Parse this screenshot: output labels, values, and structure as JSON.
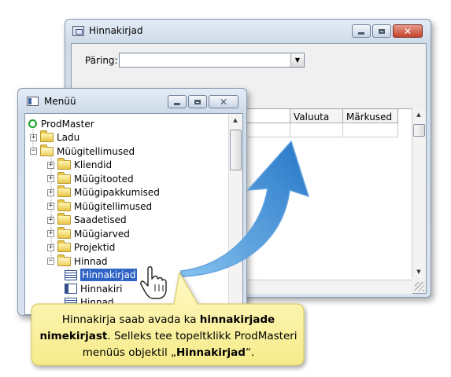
{
  "back_window": {
    "title": "Hinnakirjad",
    "query_label": "Päring:",
    "query_value": "",
    "columns": [
      "Valuuta",
      "Märkused"
    ]
  },
  "menu_window": {
    "title": "Menüü",
    "tree": [
      {
        "label": "ProdMaster",
        "level": 0,
        "type": "root"
      },
      {
        "label": "Ladu",
        "level": 1,
        "type": "folder",
        "expander": "+"
      },
      {
        "label": "Müügitellimused",
        "level": 1,
        "type": "folder-open",
        "expander": "-"
      },
      {
        "label": "Kliendid",
        "level": 2,
        "type": "folder",
        "expander": "+"
      },
      {
        "label": "Müügitooted",
        "level": 2,
        "type": "folder",
        "expander": "+"
      },
      {
        "label": "Müügipakkumised",
        "level": 2,
        "type": "folder",
        "expander": "+"
      },
      {
        "label": "Müügitellimused",
        "level": 2,
        "type": "folder",
        "expander": "+"
      },
      {
        "label": "Saadetised",
        "level": 2,
        "type": "folder",
        "expander": "+"
      },
      {
        "label": "Müügiarved",
        "level": 2,
        "type": "folder",
        "expander": "+"
      },
      {
        "label": "Projektid",
        "level": 2,
        "type": "folder",
        "expander": "+"
      },
      {
        "label": "Hinnad",
        "level": 2,
        "type": "folder-open",
        "expander": "-"
      },
      {
        "label": "Hinnakirjad",
        "level": 3,
        "type": "doc",
        "selected": true
      },
      {
        "label": "Hinnakiri",
        "level": 3,
        "type": "doc-alt"
      },
      {
        "label": "Hinnad",
        "level": 3,
        "type": "doc"
      }
    ]
  },
  "callout": {
    "part1": "Hinnakirja saab avada ka ",
    "bold1": "hinnakirjade nimekirjast",
    "part2": ". Selleks tee topeltklikk ProdMasteri menüüs objektil „",
    "bold2": "Hinnakirjad",
    "part3": "“."
  },
  "colors": {
    "selection": "#2f63c4",
    "arrow": "#2a7fd0",
    "callout_fill": "#fbf3a6",
    "close_button": "#c6422b"
  }
}
